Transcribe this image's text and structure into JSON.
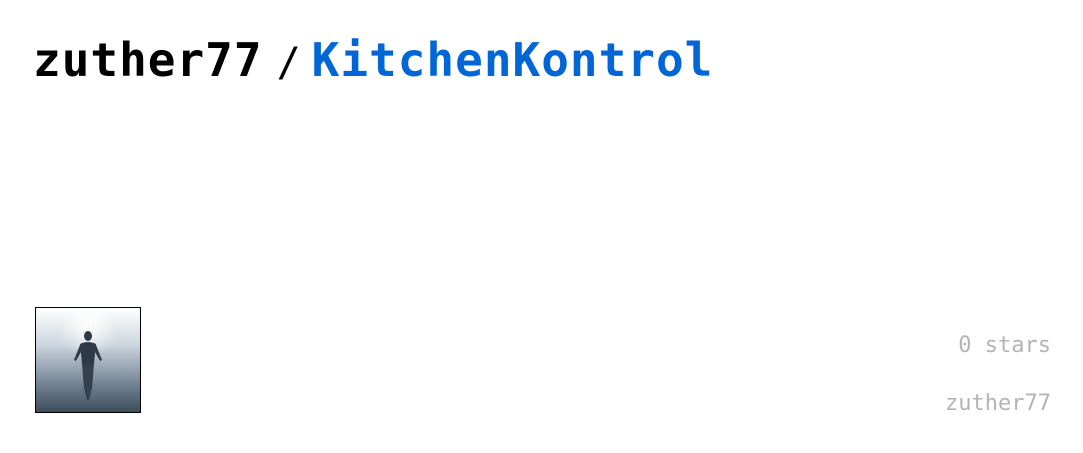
{
  "repo_card": {
    "owner": "zuther77",
    "separator": "/",
    "repo_name": "KitchenKontrol",
    "stars_text": "0 stars",
    "author": "zuther77"
  },
  "avatar": {
    "icon": "avatar-image"
  },
  "colors": {
    "owner": "#000000",
    "repo_link": "#0366d6",
    "meta_text": "#b4b4b4",
    "background": "#ffffff"
  }
}
